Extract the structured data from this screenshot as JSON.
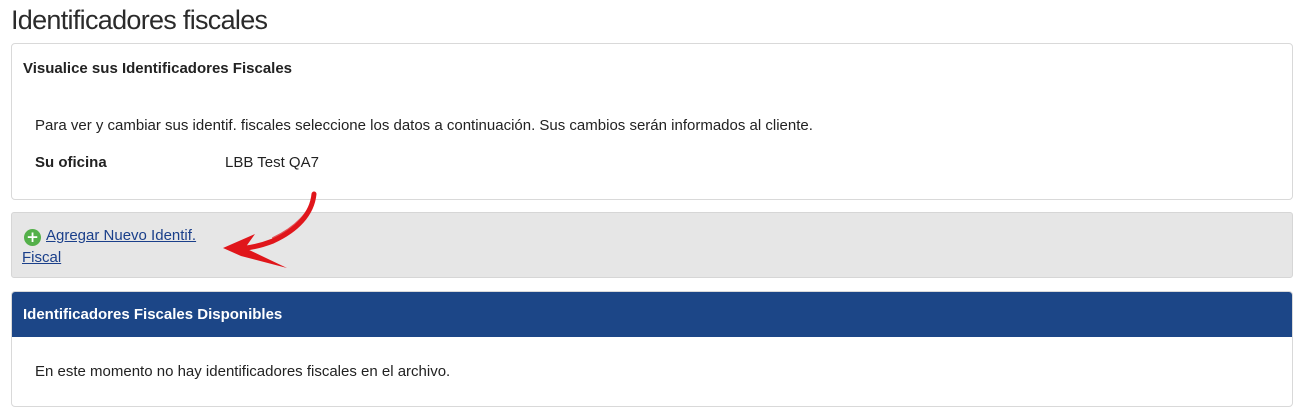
{
  "page": {
    "title": "Identificadores fiscales"
  },
  "view_panel": {
    "title": "Visualice sus Identificadores Fiscales",
    "description": "Para ver y cambiar sus identif. fiscales seleccione los datos a continuación. Sus cambios serán informados al cliente.",
    "office_label": "Su oficina",
    "office_value": "LBB Test QA7"
  },
  "actions": {
    "add_label": "Agregar Nuevo Identif. Fiscal",
    "icon": "plus-circle-icon"
  },
  "available_panel": {
    "title": "Identificadores Fiscales Disponibles",
    "empty_message": "En este momento no hay identificadores fiscales en el archivo."
  },
  "colors": {
    "header_blue": "#1c4687",
    "link_blue": "#1a3f8a",
    "add_icon_green": "#54b04a",
    "annotation_arrow_red": "#e0161b",
    "action_bar_bg": "#e6e6e6"
  }
}
